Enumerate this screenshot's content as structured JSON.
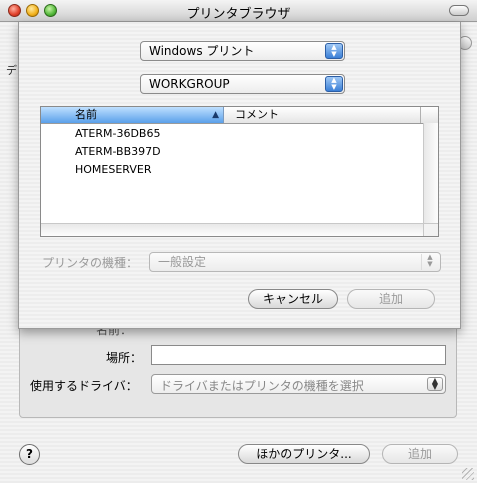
{
  "window": {
    "title": "プリンタブラウザ"
  },
  "background": {
    "edge_text": "デ",
    "location_label": "場所：",
    "driver_label": "使用するドライバ：",
    "driver_select_value": "ドライバまたはプリンタの機種を選択",
    "partial_label": "名前："
  },
  "sheet": {
    "connection_popup": "Windows プリント",
    "workgroup_popup": "WORKGROUP",
    "table": {
      "columns": [
        "名前",
        "コメント"
      ],
      "rows": [
        {
          "name": "ATERM-36DB65",
          "comment": ""
        },
        {
          "name": "ATERM-BB397D",
          "comment": ""
        },
        {
          "name": "HOMESERVER",
          "comment": ""
        }
      ]
    },
    "printer_model_label": "プリンタの機種：",
    "printer_model_value": "一般設定",
    "cancel_label": "キャンセル",
    "add_label": "追加"
  },
  "footer": {
    "help_label": "?",
    "other_printer_label": "ほかのプリンタ...",
    "add_label": "追加"
  }
}
